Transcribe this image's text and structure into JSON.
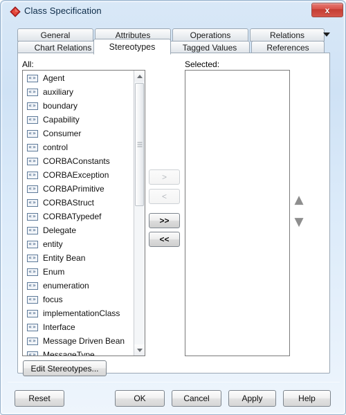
{
  "window": {
    "title": "Class Specification",
    "icon": "red-diamond-icon",
    "close_label": "x",
    "frame_color": "#9cb4cc",
    "titlebar_gradient_top": "#d9e8f7",
    "close_button_color": "#c43d33"
  },
  "tabs": {
    "row1": [
      {
        "label": "General",
        "selected": false
      },
      {
        "label": "Attributes",
        "selected": false
      },
      {
        "label": "Operations",
        "selected": false
      },
      {
        "label": "Relations",
        "selected": false
      }
    ],
    "row2": [
      {
        "label": "Chart Relations",
        "selected": false
      },
      {
        "label": "Stereotypes",
        "selected": true
      },
      {
        "label": "Tagged Values",
        "selected": false
      },
      {
        "label": "References",
        "selected": false
      }
    ],
    "overflow_icon": "chevron-down-icon"
  },
  "panel": {
    "all_label": "All:",
    "selected_label": "Selected:",
    "all_items": [
      "Agent",
      "auxiliary",
      "boundary",
      "Capability",
      "Consumer",
      "control",
      "CORBAConstants",
      "CORBAException",
      "CORBAPrimitive",
      "CORBAStruct",
      "CORBATypedef",
      "Delegate",
      "entity",
      "Entity Bean",
      "Enum",
      "enumeration",
      "focus",
      "implementationClass",
      "Interface",
      "Message Driven Bean",
      "MessageType"
    ],
    "selected_items": [],
    "item_icon": "stereotype-guillemet-icon"
  },
  "transfer_buttons": [
    {
      "label": ">",
      "name": "move-right-button",
      "enabled": false
    },
    {
      "label": "<",
      "name": "move-left-button",
      "enabled": false
    },
    {
      "label": ">>",
      "name": "move-all-right-button",
      "enabled": true
    },
    {
      "label": "<<",
      "name": "move-all-left-button",
      "enabled": true
    }
  ],
  "order_buttons": [
    {
      "glyph": "▲",
      "name": "move-up-button"
    },
    {
      "glyph": "▼",
      "name": "move-down-button"
    }
  ],
  "actions": {
    "edit_stereotypes": "Edit Stereotypes...",
    "reset": "Reset",
    "ok": "OK",
    "cancel": "Cancel",
    "apply": "Apply",
    "help": "Help"
  },
  "scrollbar": {
    "up_icon": "scroll-up-arrow-icon",
    "down_icon": "scroll-down-arrow-icon",
    "thumb_position_pct": 0,
    "visible_fraction_pct": 45
  }
}
